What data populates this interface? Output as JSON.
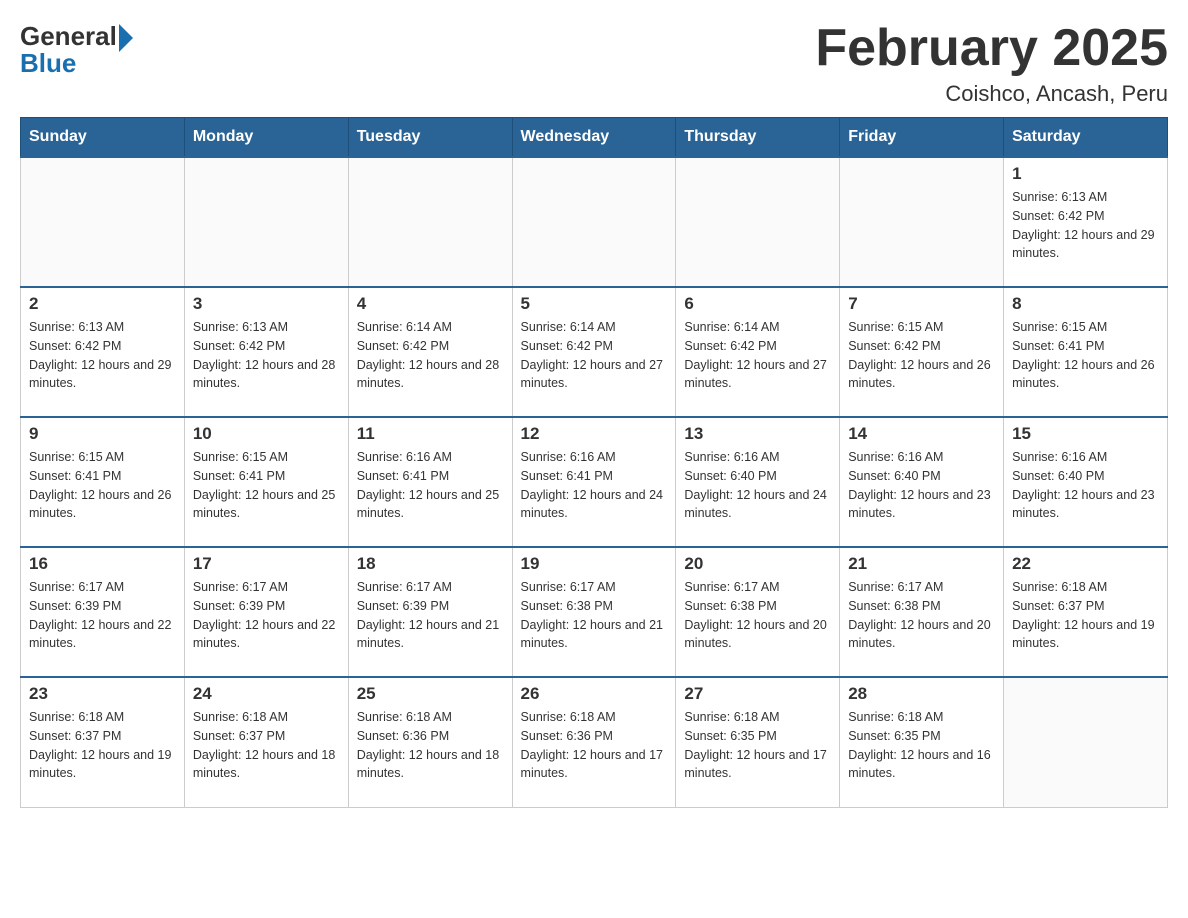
{
  "logo": {
    "general": "General",
    "blue": "Blue"
  },
  "title": "February 2025",
  "subtitle": "Coishco, Ancash, Peru",
  "days_of_week": [
    "Sunday",
    "Monday",
    "Tuesday",
    "Wednesday",
    "Thursday",
    "Friday",
    "Saturday"
  ],
  "weeks": [
    [
      {
        "day": "",
        "info": ""
      },
      {
        "day": "",
        "info": ""
      },
      {
        "day": "",
        "info": ""
      },
      {
        "day": "",
        "info": ""
      },
      {
        "day": "",
        "info": ""
      },
      {
        "day": "",
        "info": ""
      },
      {
        "day": "1",
        "info": "Sunrise: 6:13 AM\nSunset: 6:42 PM\nDaylight: 12 hours and 29 minutes."
      }
    ],
    [
      {
        "day": "2",
        "info": "Sunrise: 6:13 AM\nSunset: 6:42 PM\nDaylight: 12 hours and 29 minutes."
      },
      {
        "day": "3",
        "info": "Sunrise: 6:13 AM\nSunset: 6:42 PM\nDaylight: 12 hours and 28 minutes."
      },
      {
        "day": "4",
        "info": "Sunrise: 6:14 AM\nSunset: 6:42 PM\nDaylight: 12 hours and 28 minutes."
      },
      {
        "day": "5",
        "info": "Sunrise: 6:14 AM\nSunset: 6:42 PM\nDaylight: 12 hours and 27 minutes."
      },
      {
        "day": "6",
        "info": "Sunrise: 6:14 AM\nSunset: 6:42 PM\nDaylight: 12 hours and 27 minutes."
      },
      {
        "day": "7",
        "info": "Sunrise: 6:15 AM\nSunset: 6:42 PM\nDaylight: 12 hours and 26 minutes."
      },
      {
        "day": "8",
        "info": "Sunrise: 6:15 AM\nSunset: 6:41 PM\nDaylight: 12 hours and 26 minutes."
      }
    ],
    [
      {
        "day": "9",
        "info": "Sunrise: 6:15 AM\nSunset: 6:41 PM\nDaylight: 12 hours and 26 minutes."
      },
      {
        "day": "10",
        "info": "Sunrise: 6:15 AM\nSunset: 6:41 PM\nDaylight: 12 hours and 25 minutes."
      },
      {
        "day": "11",
        "info": "Sunrise: 6:16 AM\nSunset: 6:41 PM\nDaylight: 12 hours and 25 minutes."
      },
      {
        "day": "12",
        "info": "Sunrise: 6:16 AM\nSunset: 6:41 PM\nDaylight: 12 hours and 24 minutes."
      },
      {
        "day": "13",
        "info": "Sunrise: 6:16 AM\nSunset: 6:40 PM\nDaylight: 12 hours and 24 minutes."
      },
      {
        "day": "14",
        "info": "Sunrise: 6:16 AM\nSunset: 6:40 PM\nDaylight: 12 hours and 23 minutes."
      },
      {
        "day": "15",
        "info": "Sunrise: 6:16 AM\nSunset: 6:40 PM\nDaylight: 12 hours and 23 minutes."
      }
    ],
    [
      {
        "day": "16",
        "info": "Sunrise: 6:17 AM\nSunset: 6:39 PM\nDaylight: 12 hours and 22 minutes."
      },
      {
        "day": "17",
        "info": "Sunrise: 6:17 AM\nSunset: 6:39 PM\nDaylight: 12 hours and 22 minutes."
      },
      {
        "day": "18",
        "info": "Sunrise: 6:17 AM\nSunset: 6:39 PM\nDaylight: 12 hours and 21 minutes."
      },
      {
        "day": "19",
        "info": "Sunrise: 6:17 AM\nSunset: 6:38 PM\nDaylight: 12 hours and 21 minutes."
      },
      {
        "day": "20",
        "info": "Sunrise: 6:17 AM\nSunset: 6:38 PM\nDaylight: 12 hours and 20 minutes."
      },
      {
        "day": "21",
        "info": "Sunrise: 6:17 AM\nSunset: 6:38 PM\nDaylight: 12 hours and 20 minutes."
      },
      {
        "day": "22",
        "info": "Sunrise: 6:18 AM\nSunset: 6:37 PM\nDaylight: 12 hours and 19 minutes."
      }
    ],
    [
      {
        "day": "23",
        "info": "Sunrise: 6:18 AM\nSunset: 6:37 PM\nDaylight: 12 hours and 19 minutes."
      },
      {
        "day": "24",
        "info": "Sunrise: 6:18 AM\nSunset: 6:37 PM\nDaylight: 12 hours and 18 minutes."
      },
      {
        "day": "25",
        "info": "Sunrise: 6:18 AM\nSunset: 6:36 PM\nDaylight: 12 hours and 18 minutes."
      },
      {
        "day": "26",
        "info": "Sunrise: 6:18 AM\nSunset: 6:36 PM\nDaylight: 12 hours and 17 minutes."
      },
      {
        "day": "27",
        "info": "Sunrise: 6:18 AM\nSunset: 6:35 PM\nDaylight: 12 hours and 17 minutes."
      },
      {
        "day": "28",
        "info": "Sunrise: 6:18 AM\nSunset: 6:35 PM\nDaylight: 12 hours and 16 minutes."
      },
      {
        "day": "",
        "info": ""
      }
    ]
  ]
}
